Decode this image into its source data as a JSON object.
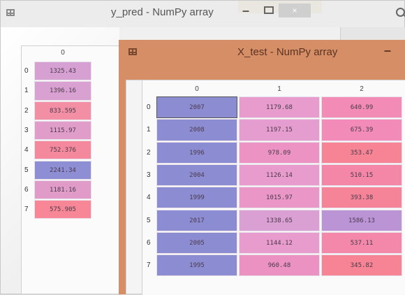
{
  "y_pred_window": {
    "title": "y_pred - NumPy array",
    "minimize": "–",
    "close": "×",
    "column_header": "0",
    "rows": [
      {
        "index": "0",
        "value": "1325.43",
        "color": "#d7a0d3"
      },
      {
        "index": "1",
        "value": "1396.16",
        "color": "#d9a1d2"
      },
      {
        "index": "2",
        "value": "833.595",
        "color": "#f28fa5"
      },
      {
        "index": "3",
        "value": "1115.97",
        "color": "#e19dc9"
      },
      {
        "index": "4",
        "value": "752.376",
        "color": "#f4889c"
      },
      {
        "index": "5",
        "value": "2241.34",
        "color": "#8e8ed4"
      },
      {
        "index": "6",
        "value": "1181.16",
        "color": "#e09bc8"
      },
      {
        "index": "7",
        "value": "575.905",
        "color": "#f78796"
      }
    ]
  },
  "x_test_window": {
    "title": "X_test - NumPy array",
    "minimize": "–",
    "column_headers": [
      "0",
      "1",
      "2"
    ],
    "rows": [
      {
        "index": "0",
        "cells": [
          {
            "v": "2007",
            "c": "#8c8cd3"
          },
          {
            "v": "1179.68",
            "c": "#e79ccd"
          },
          {
            "v": "640.99",
            "c": "#f28bb6"
          }
        ]
      },
      {
        "index": "1",
        "cells": [
          {
            "v": "2008",
            "c": "#8c8cd3"
          },
          {
            "v": "1197.15",
            "c": "#e59cce"
          },
          {
            "v": "675.39",
            "c": "#f28bb8"
          }
        ]
      },
      {
        "index": "2",
        "cells": [
          {
            "v": "1996",
            "c": "#8c8cd3"
          },
          {
            "v": "978.09",
            "c": "#ec93c4"
          },
          {
            "v": "353.47",
            "c": "#f68495"
          }
        ]
      },
      {
        "index": "3",
        "cells": [
          {
            "v": "2004",
            "c": "#8c8cd3"
          },
          {
            "v": "1126.14",
            "c": "#e89ccd"
          },
          {
            "v": "510.15",
            "c": "#f487a7"
          }
        ]
      },
      {
        "index": "4",
        "cells": [
          {
            "v": "1999",
            "c": "#8c8cd3"
          },
          {
            "v": "1015.97",
            "c": "#ea97c8"
          },
          {
            "v": "393.38",
            "c": "#f68498"
          }
        ]
      },
      {
        "index": "5",
        "cells": [
          {
            "v": "2017",
            "c": "#8c8cd3"
          },
          {
            "v": "1338.65",
            "c": "#da9fd3"
          },
          {
            "v": "1586.13",
            "c": "#bb94d6"
          }
        ]
      },
      {
        "index": "6",
        "cells": [
          {
            "v": "2005",
            "c": "#8c8cd3"
          },
          {
            "v": "1144.12",
            "c": "#e79ccd"
          },
          {
            "v": "537.11",
            "c": "#f388aa"
          }
        ]
      },
      {
        "index": "7",
        "cells": [
          {
            "v": "1995",
            "c": "#8c8cd3"
          },
          {
            "v": "960.48",
            "c": "#ec92c3"
          },
          {
            "v": "345.82",
            "c": "#f68494"
          }
        ]
      }
    ]
  }
}
